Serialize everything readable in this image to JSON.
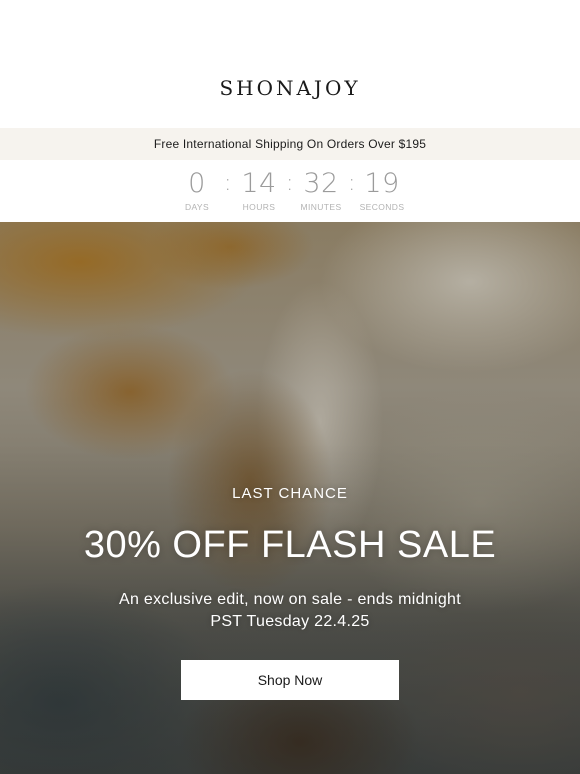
{
  "brand": {
    "logo_text": "SHONAJOY"
  },
  "shipping_banner": {
    "text": "Free International Shipping On Orders Over $195"
  },
  "countdown": {
    "units": [
      {
        "value": "0",
        "label": "DAYS"
      },
      {
        "value": "14",
        "label": "HOURS"
      },
      {
        "value": "32",
        "label": "MINUTES"
      },
      {
        "value": "19",
        "label": "SECONDS"
      }
    ],
    "separator": ":"
  },
  "hero": {
    "kicker": "LAST CHANCE",
    "headline": "30% OFF FLASH SALE",
    "subline_1": "An exclusive edit, now on sale - ends midnight",
    "subline_2": "PST Tuesday 22.4.25",
    "cta_label": "Shop Now"
  }
}
